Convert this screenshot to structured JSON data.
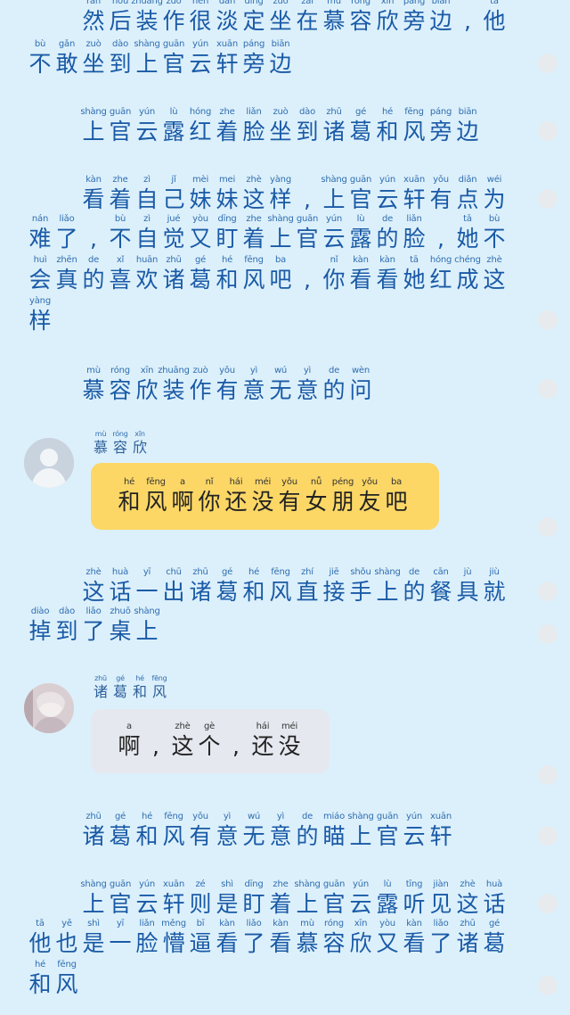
{
  "story": {
    "lines": [
      {
        "chars": [
          [
            "rán",
            "然"
          ],
          [
            "hòu",
            "后"
          ],
          [
            "zhuāng",
            "装"
          ],
          [
            "zuò",
            "作"
          ],
          [
            "hěn",
            "很"
          ],
          [
            "dàn",
            "淡"
          ],
          [
            "dìng",
            "定"
          ],
          [
            "zuò",
            "坐"
          ],
          [
            "zài",
            "在"
          ],
          [
            "mù",
            "慕"
          ],
          [
            "róng",
            "容"
          ],
          [
            "xīn",
            "欣"
          ],
          [
            "páng",
            "旁"
          ],
          [
            "biān",
            "边"
          ],
          [
            "",
            ","
          ],
          [
            "tā",
            "他"
          ]
        ]
      },
      {
        "chars": [
          [
            "bù",
            "不"
          ],
          [
            "gǎn",
            "敢"
          ],
          [
            "zuò",
            "坐"
          ],
          [
            "dào",
            "到"
          ],
          [
            "shàng",
            "上"
          ],
          [
            "guān",
            "官"
          ],
          [
            "yún",
            "云"
          ],
          [
            "xuān",
            "轩"
          ],
          [
            "páng",
            "旁"
          ],
          [
            "biān",
            "边"
          ]
        ]
      },
      {
        "chars": [
          [
            "shàng",
            "上"
          ],
          [
            "guān",
            "官"
          ],
          [
            "yún",
            "云"
          ],
          [
            "lù",
            "露"
          ],
          [
            "hóng",
            "红"
          ],
          [
            "zhe",
            "着"
          ],
          [
            "liǎn",
            "脸"
          ],
          [
            "zuò",
            "坐"
          ],
          [
            "dào",
            "到"
          ],
          [
            "zhū",
            "诸"
          ],
          [
            "gé",
            "葛"
          ],
          [
            "hé",
            "和"
          ],
          [
            "fēng",
            "风"
          ],
          [
            "páng",
            "旁"
          ],
          [
            "biān",
            "边"
          ]
        ]
      },
      {
        "chars": [
          [
            "kàn",
            "看"
          ],
          [
            "zhe",
            "着"
          ],
          [
            "zì",
            "自"
          ],
          [
            "jǐ",
            "己"
          ],
          [
            "mèi",
            "妹"
          ],
          [
            "mei",
            "妹"
          ],
          [
            "zhè",
            "这"
          ],
          [
            "yàng",
            "样"
          ],
          [
            "",
            ","
          ],
          [
            "shàng",
            "上"
          ],
          [
            "guān",
            "官"
          ],
          [
            "yún",
            "云"
          ],
          [
            "xuān",
            "轩"
          ],
          [
            "yǒu",
            "有"
          ],
          [
            "diǎn",
            "点"
          ],
          [
            "wéi",
            "为"
          ]
        ]
      },
      {
        "chars": [
          [
            "nán",
            "难"
          ],
          [
            "liǎo",
            "了"
          ],
          [
            "",
            ","
          ],
          [
            "bù",
            "不"
          ],
          [
            "zì",
            "自"
          ],
          [
            "jué",
            "觉"
          ],
          [
            "yòu",
            "又"
          ],
          [
            "dīng",
            "盯"
          ],
          [
            "zhe",
            "着"
          ],
          [
            "shàng",
            "上"
          ],
          [
            "guān",
            "官"
          ],
          [
            "yún",
            "云"
          ],
          [
            "lù",
            "露"
          ],
          [
            "de",
            "的"
          ],
          [
            "liǎn",
            "脸"
          ],
          [
            "",
            ","
          ],
          [
            "tā",
            "她"
          ],
          [
            "bù",
            "不"
          ]
        ]
      },
      {
        "chars": [
          [
            "huì",
            "会"
          ],
          [
            "zhēn",
            "真"
          ],
          [
            "de",
            "的"
          ],
          [
            "xǐ",
            "喜"
          ],
          [
            "huān",
            "欢"
          ],
          [
            "zhū",
            "诸"
          ],
          [
            "gé",
            "葛"
          ],
          [
            "hé",
            "和"
          ],
          [
            "fēng",
            "风"
          ],
          [
            "ba",
            "吧"
          ],
          [
            "",
            ","
          ],
          [
            "nǐ",
            "你"
          ],
          [
            "kàn",
            "看"
          ],
          [
            "kàn",
            "看"
          ],
          [
            "tā",
            "她"
          ],
          [
            "hóng",
            "红"
          ],
          [
            "chéng",
            "成"
          ],
          [
            "zhè",
            "这"
          ]
        ]
      },
      {
        "chars": [
          [
            "yàng",
            "样"
          ]
        ]
      },
      {
        "chars": [
          [
            "mù",
            "慕"
          ],
          [
            "róng",
            "容"
          ],
          [
            "xīn",
            "欣"
          ],
          [
            "zhuāng",
            "装"
          ],
          [
            "zuò",
            "作"
          ],
          [
            "yǒu",
            "有"
          ],
          [
            "yì",
            "意"
          ],
          [
            "wú",
            "无"
          ],
          [
            "yì",
            "意"
          ],
          [
            "de",
            "的"
          ],
          [
            "wèn",
            "问"
          ]
        ]
      },
      {
        "chars": [
          [
            "zhè",
            "这"
          ],
          [
            "huà",
            "话"
          ],
          [
            "yī",
            "一"
          ],
          [
            "chū",
            "出"
          ],
          [
            "zhū",
            "诸"
          ],
          [
            "gé",
            "葛"
          ],
          [
            "hé",
            "和"
          ],
          [
            "fēng",
            "风"
          ],
          [
            "zhí",
            "直"
          ],
          [
            "jiē",
            "接"
          ],
          [
            "shǒu",
            "手"
          ],
          [
            "shàng",
            "上"
          ],
          [
            "de",
            "的"
          ],
          [
            "cān",
            "餐"
          ],
          [
            "jù",
            "具"
          ],
          [
            "jiù",
            "就"
          ]
        ]
      },
      {
        "chars": [
          [
            "diào",
            "掉"
          ],
          [
            "dào",
            "到"
          ],
          [
            "liǎo",
            "了"
          ],
          [
            "zhuō",
            "桌"
          ],
          [
            "shàng",
            "上"
          ]
        ]
      },
      {
        "chars": [
          [
            "zhū",
            "诸"
          ],
          [
            "gé",
            "葛"
          ],
          [
            "hé",
            "和"
          ],
          [
            "fēng",
            "风"
          ],
          [
            "yǒu",
            "有"
          ],
          [
            "yì",
            "意"
          ],
          [
            "wú",
            "无"
          ],
          [
            "yì",
            "意"
          ],
          [
            "de",
            "的"
          ],
          [
            "miáo",
            "瞄"
          ],
          [
            "shàng",
            "上"
          ],
          [
            "guān",
            "官"
          ],
          [
            "yún",
            "云"
          ],
          [
            "xuān",
            "轩"
          ]
        ]
      },
      {
        "chars": [
          [
            "shàng",
            "上"
          ],
          [
            "guān",
            "官"
          ],
          [
            "yún",
            "云"
          ],
          [
            "xuān",
            "轩"
          ],
          [
            "zé",
            "则"
          ],
          [
            "shì",
            "是"
          ],
          [
            "dīng",
            "盯"
          ],
          [
            "zhe",
            "着"
          ],
          [
            "shàng",
            "上"
          ],
          [
            "guān",
            "官"
          ],
          [
            "yún",
            "云"
          ],
          [
            "lù",
            "露"
          ],
          [
            "tīng",
            "听"
          ],
          [
            "jiàn",
            "见"
          ],
          [
            "zhè",
            "这"
          ],
          [
            "huà",
            "话"
          ]
        ]
      },
      {
        "chars": [
          [
            "tā",
            "他"
          ],
          [
            "yě",
            "也"
          ],
          [
            "shì",
            "是"
          ],
          [
            "yī",
            "一"
          ],
          [
            "liǎn",
            "脸"
          ],
          [
            "měng",
            "懵"
          ],
          [
            "bī",
            "逼"
          ],
          [
            "kàn",
            "看"
          ],
          [
            "liǎo",
            "了"
          ],
          [
            "kàn",
            "看"
          ],
          [
            "mù",
            "慕"
          ],
          [
            "róng",
            "容"
          ],
          [
            "xīn",
            "欣"
          ],
          [
            "yòu",
            "又"
          ],
          [
            "kàn",
            "看"
          ],
          [
            "liǎo",
            "了"
          ],
          [
            "zhū",
            "诸"
          ],
          [
            "gé",
            "葛"
          ]
        ]
      },
      {
        "chars": [
          [
            "hé",
            "和"
          ],
          [
            "fēng",
            "风"
          ]
        ]
      }
    ]
  },
  "chat": {
    "message1": {
      "sender": [
        [
          "mù",
          "慕"
        ],
        [
          "róng",
          "容"
        ],
        [
          "xīn",
          "欣"
        ]
      ],
      "text": [
        [
          "hé",
          "和"
        ],
        [
          "fēng",
          "风"
        ],
        [
          "a",
          "啊"
        ],
        [
          "nǐ",
          "你"
        ],
        [
          "hái",
          "还"
        ],
        [
          "méi",
          "没"
        ],
        [
          "yǒu",
          "有"
        ],
        [
          "nǚ",
          "女"
        ],
        [
          "péng",
          "朋"
        ],
        [
          "yǒu",
          "友"
        ],
        [
          "ba",
          "吧"
        ]
      ],
      "bubble_color": "#fcd766"
    },
    "message2": {
      "sender": [
        [
          "zhū",
          "诸"
        ],
        [
          "gé",
          "葛"
        ],
        [
          "hé",
          "和"
        ],
        [
          "fēng",
          "风"
        ]
      ],
      "text": [
        [
          "a",
          "啊"
        ],
        [
          "",
          ","
        ],
        [
          "zhè",
          "这"
        ],
        [
          "gè",
          "个"
        ],
        [
          "",
          ","
        ],
        [
          "hái",
          "还"
        ],
        [
          "méi",
          "没"
        ]
      ],
      "bubble_color": "#e5e8ef"
    }
  },
  "colors": {
    "background": "#dcf0fb",
    "text": "#1a5aa6",
    "scroll_dot": "#e7ebee"
  }
}
